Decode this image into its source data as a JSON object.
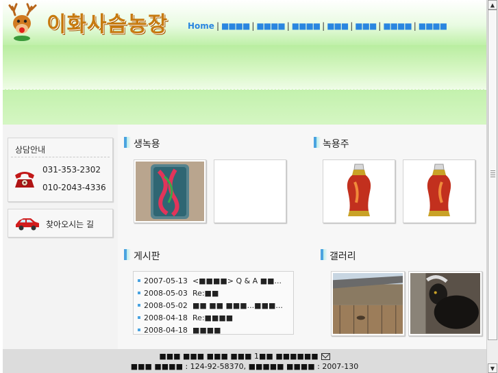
{
  "header": {
    "site_title": "이화사슴농장",
    "nav": {
      "home": "Home",
      "separator": "|",
      "items": [
        "■■■■",
        "■■■■",
        "■■■■",
        "■■■",
        "■■■",
        "■■■■",
        "■■■■"
      ]
    }
  },
  "sidebar": {
    "consult": {
      "title": "상담안내",
      "phone1": "031-353-2302",
      "phone2": "010-2043-4336",
      "icon": "telephone-icon"
    },
    "directions": {
      "label": "찾아오시는 길",
      "icon": "car-icon"
    }
  },
  "sections": {
    "fresh_antler": {
      "title": "생녹용"
    },
    "antler_liquor": {
      "title": "녹용주"
    },
    "board": {
      "title": "게시판",
      "posts": [
        {
          "date": "2007-05-13",
          "title": "<■■■■> Q & A ■■..."
        },
        {
          "date": "2008-05-03",
          "title": "Re:■■"
        },
        {
          "date": "2008-05-02",
          "title": "■■ ■■ ■■■...■■■..."
        },
        {
          "date": "2008-04-18",
          "title": "Re:■■■■"
        },
        {
          "date": "2008-04-18",
          "title": "■■■■"
        }
      ]
    },
    "gallery": {
      "title": "갤러리"
    }
  },
  "footer": {
    "line1": "■■■ ■■■ ■■■ ■■■ 1■■ ■■■■■■",
    "line2": "■■■ ■■■■ : 124-92-58370, ■■■■■ ■■■■ : 2007-130"
  },
  "colors": {
    "nav_text": "#2a86e0",
    "header_green": "#bff0a8",
    "title_gold": "#c77a10",
    "section_mark": "#4aa3e0"
  }
}
